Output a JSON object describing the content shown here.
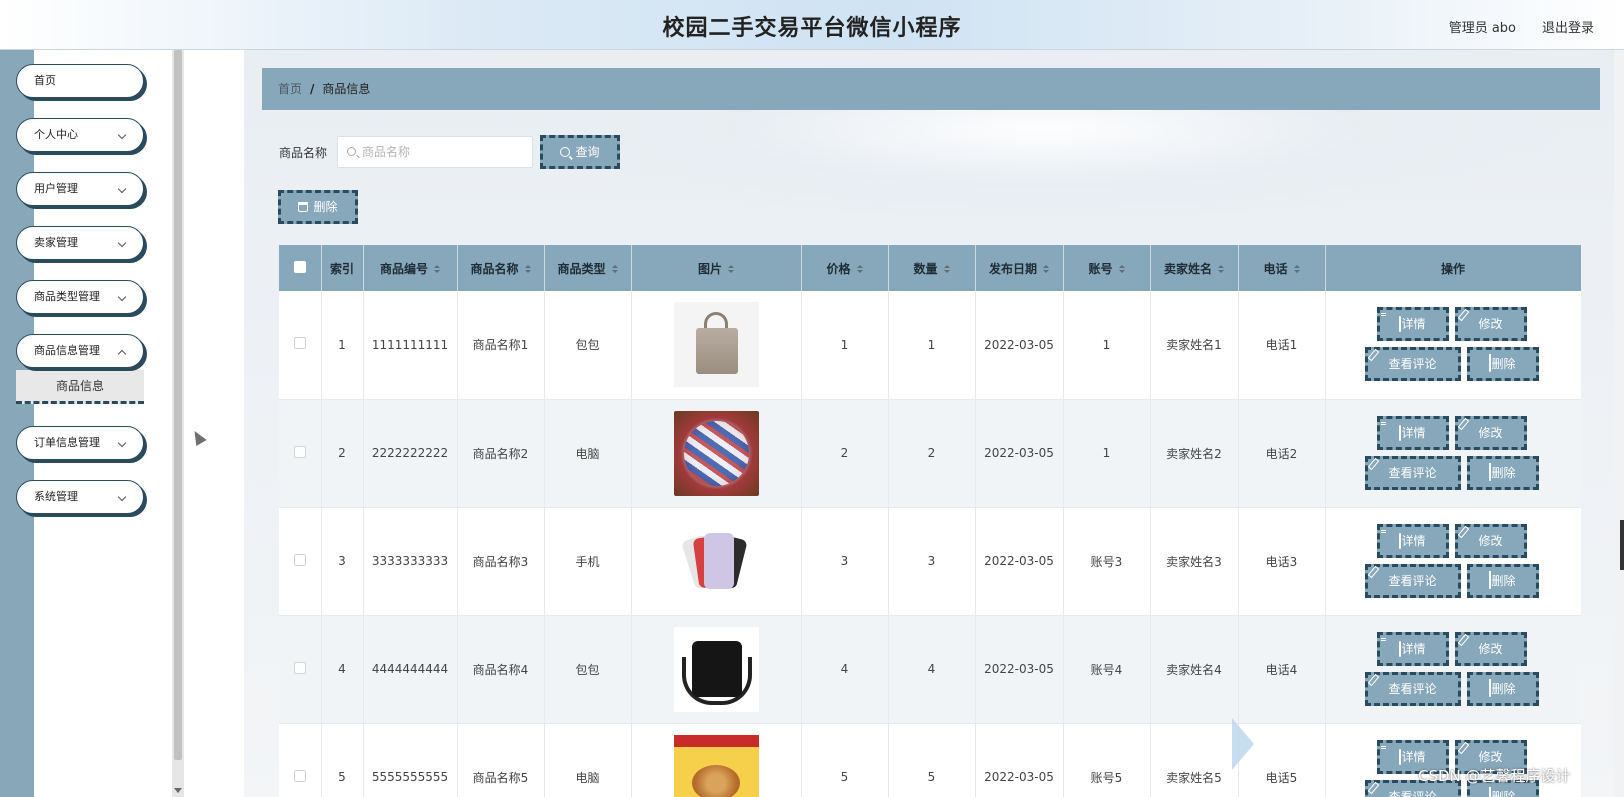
{
  "header": {
    "title": "校园二手交易平台微信小程序",
    "user": "管理员 abo",
    "logout": "退出登录"
  },
  "sidebar": {
    "items": [
      {
        "label": "首页"
      },
      {
        "label": "个人中心"
      },
      {
        "label": "用户管理"
      },
      {
        "label": "卖家管理"
      },
      {
        "label": "商品类型管理"
      },
      {
        "label": "商品信息管理"
      },
      {
        "label": "订单信息管理"
      },
      {
        "label": "系统管理"
      }
    ],
    "active_sub": "商品信息"
  },
  "breadcrumb": {
    "home": "首页",
    "separator": "/",
    "current": "商品信息"
  },
  "search": {
    "label": "商品名称",
    "placeholder": "商品名称",
    "value": "",
    "query_button": "查询",
    "delete_button": "删除"
  },
  "table": {
    "headers": [
      "索引",
      "商品编号",
      "商品名称",
      "商品类型",
      "图片",
      "价格",
      "数量",
      "发布日期",
      "账号",
      "卖家姓名",
      "电话",
      "操作"
    ],
    "rows": [
      {
        "index": "1",
        "code": "1111111111",
        "name": "商品名称1",
        "type": "包包",
        "image": "handbag",
        "price": "1",
        "qty": "1",
        "date": "2022-03-05",
        "account": "1",
        "seller": "卖家姓名1",
        "phone": "电话1"
      },
      {
        "index": "2",
        "code": "2222222222",
        "name": "商品名称2",
        "type": "电脑",
        "image": "candy",
        "price": "2",
        "qty": "2",
        "date": "2022-03-05",
        "account": "1",
        "seller": "卖家姓名2",
        "phone": "电话2"
      },
      {
        "index": "3",
        "code": "3333333333",
        "name": "商品名称3",
        "type": "手机",
        "image": "phones",
        "price": "3",
        "qty": "3",
        "date": "2022-03-05",
        "account": "账号3",
        "seller": "卖家姓名3",
        "phone": "电话3"
      },
      {
        "index": "4",
        "code": "4444444444",
        "name": "商品名称4",
        "type": "包包",
        "image": "crossbody-bag",
        "price": "4",
        "qty": "4",
        "date": "2022-03-05",
        "account": "账号4",
        "seller": "卖家姓名4",
        "phone": "电话4"
      },
      {
        "index": "5",
        "code": "5555555555",
        "name": "商品名称5",
        "type": "电脑",
        "image": "snack-box",
        "price": "5",
        "qty": "5",
        "date": "2022-03-05",
        "account": "账号5",
        "seller": "卖家姓名5",
        "phone": "电话5"
      }
    ],
    "actions": {
      "detail": "详情",
      "edit": "修改",
      "comments": "查看评论",
      "delete": "删除"
    }
  },
  "watermark": "CSDN @艺馨程序设计"
}
